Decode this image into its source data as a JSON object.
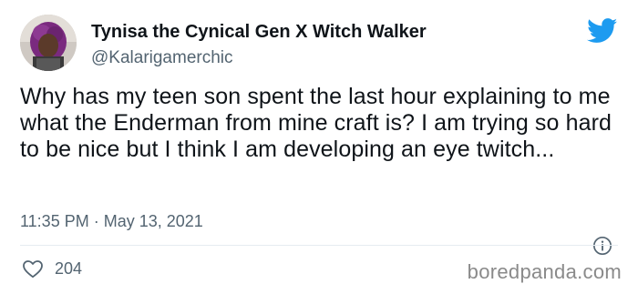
{
  "author": {
    "display_name": "Tynisa the Cynical Gen X Witch Walker",
    "handle": "@Kalarigamerchic",
    "avatar_icon": "user-avatar"
  },
  "tweet": {
    "text": "Why has my teen son spent the last hour explaining to me what the Enderman from mine craft is? I am trying so hard to be nice but I think I am developing an eye twitch...",
    "time": "11:35 PM",
    "separator": "·",
    "date": "May 13, 2021",
    "likes": "204"
  },
  "icons": {
    "brand": "twitter-bird-icon",
    "info": "info-icon",
    "like": "heart-icon"
  },
  "colors": {
    "text": "#0f1419",
    "muted": "#536471",
    "twitter_blue": "#1d9bf0",
    "divider": "#e6ecf0",
    "watermark": "#8a8a8a"
  },
  "watermark": {
    "text": "boredpanda.com"
  }
}
